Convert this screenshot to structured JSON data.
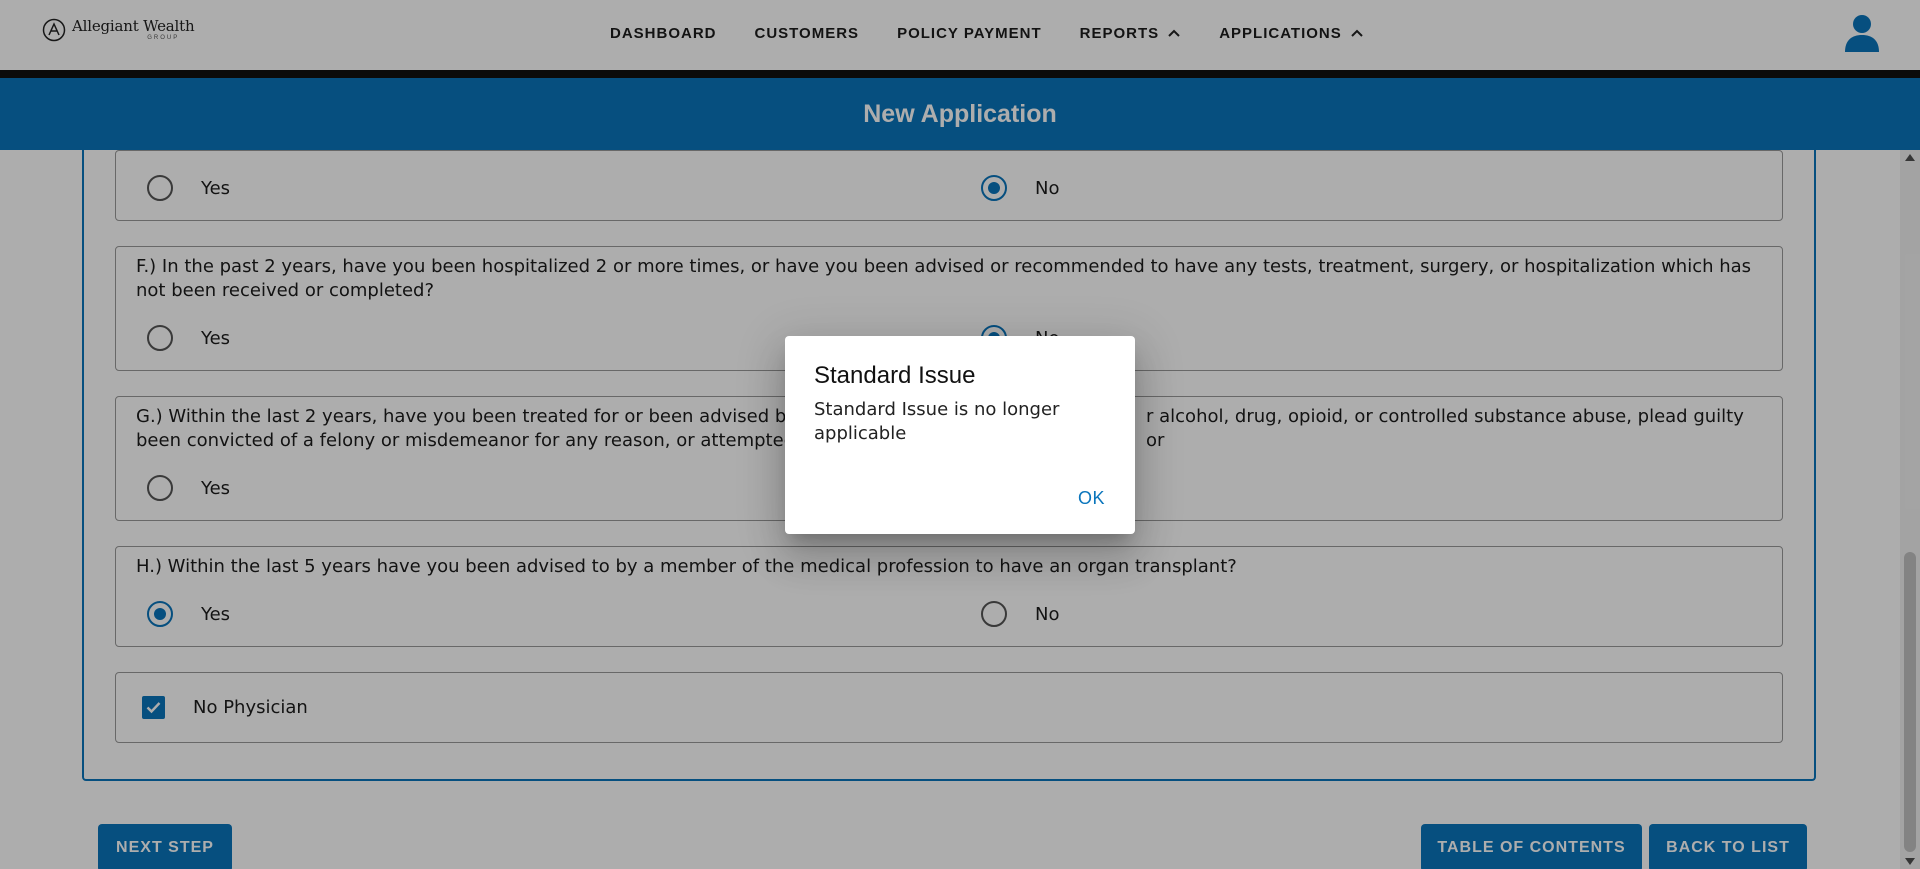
{
  "app": {
    "logo_name": "Allegiant Wealth",
    "logo_sub": "GROUP"
  },
  "nav": {
    "items": [
      {
        "label": "DASHBOARD"
      },
      {
        "label": "CUSTOMERS"
      },
      {
        "label": "POLICY PAYMENT"
      },
      {
        "label": "REPORTS",
        "icon": "chevron-up-icon"
      },
      {
        "label": "APPLICATIONS",
        "icon": "chevron-up-icon"
      }
    ],
    "user_icon": "user-account-icon"
  },
  "header": {
    "title": "New Application"
  },
  "questions": {
    "e": {
      "yes_label": "Yes",
      "no_label": "No",
      "selected": "No"
    },
    "f": {
      "text": "F.) In the past 2 years, have you been hospitalized 2 or more times, or have you been advised or recommended to have any tests, treatment, surgery, or hospitalization which has not been received or completed?",
      "yes_label": "Yes",
      "no_label": "No",
      "selected": "No"
    },
    "g": {
      "text_left": "G.) Within the last 2 years, have you been treated for or been advised by a m",
      "text_right": "r alcohol, drug, opioid, or controlled substance abuse, plead guilty or",
      "text_line2": "been convicted of a felony or misdemeanor for any reason, or attempted su",
      "yes_label": "Yes"
    },
    "h": {
      "text": "H.) Within the last 5 years have you been advised to by a member of the medical profession to have an organ transplant?",
      "yes_label": "Yes",
      "no_label": "No",
      "selected": "Yes"
    }
  },
  "no_physician": {
    "label": "No Physician",
    "checked": true
  },
  "buttons": {
    "next_step": "NEXT STEP",
    "table_of_contents": "TABLE OF CONTENTS",
    "back_to_list": "BACK TO LIST"
  },
  "dialog": {
    "title": "Standard Issue",
    "message": "Standard Issue is no longer applicable",
    "ok_label": "OK"
  },
  "colors": {
    "brand_blue": "#0a75bc"
  }
}
